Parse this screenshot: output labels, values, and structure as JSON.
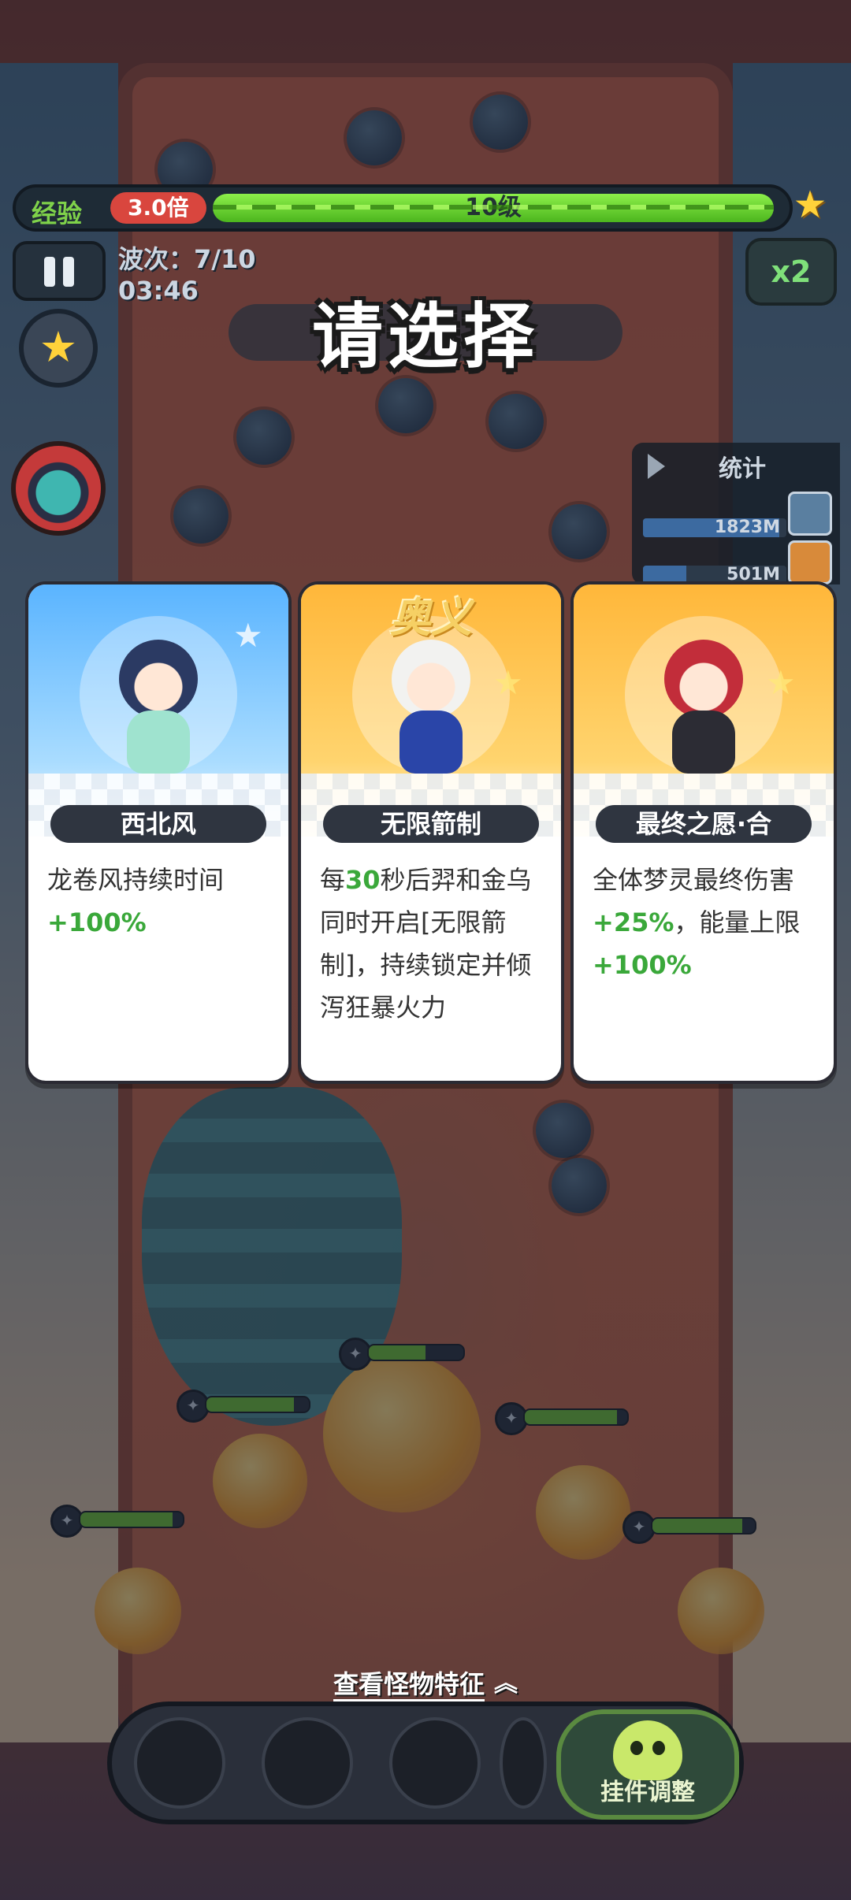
{
  "hud": {
    "exp_label": "经验",
    "exp_multiplier": "3.0倍",
    "level": "10级",
    "wave": "波次：7/10",
    "time": "03:46",
    "speed": "x2"
  },
  "prompt": {
    "title": "请选择"
  },
  "stats": {
    "title": "统计",
    "rows": [
      {
        "value": "1823M",
        "fill": 0.95
      },
      {
        "value": "501M",
        "fill": 0.3
      }
    ]
  },
  "cards": [
    {
      "name": "西北风",
      "tag": "",
      "desc_parts": [
        {
          "text": "龙卷风持续时间",
          "hl": false
        },
        {
          "text": "+100%",
          "hl": true
        }
      ]
    },
    {
      "name": "无限箭制",
      "tag": "奥义",
      "desc_parts": [
        {
          "text": "每",
          "hl": false
        },
        {
          "text": "30",
          "hl": true
        },
        {
          "text": "秒后羿和金乌同时开启[无限箭制]，持续锁定并倾泻狂暴火力",
          "hl": false
        }
      ]
    },
    {
      "name": "最终之愿·合",
      "tag": "",
      "desc_parts": [
        {
          "text": "全体梦灵最终伤害",
          "hl": false
        },
        {
          "text": "+25%",
          "hl": true
        },
        {
          "text": "，能量上限",
          "hl": false
        },
        {
          "text": "+100%",
          "hl": true
        }
      ]
    }
  ],
  "bottom": {
    "monster_link": "查看怪物特征",
    "plugin_label": "挂件调整"
  },
  "colors": {
    "exp_green": "#7fd24a",
    "multiplier_red": "#d9463e",
    "highlight_green": "#3aa83a",
    "card_blue": "#5ab4ff",
    "card_gold": "#ffb73a"
  }
}
